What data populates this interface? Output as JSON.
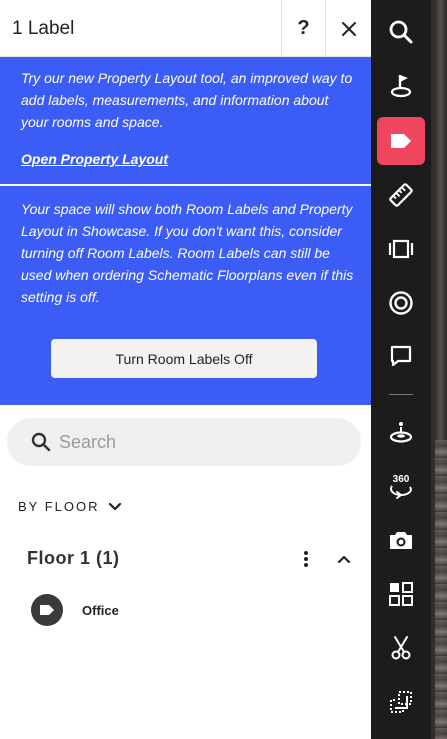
{
  "header": {
    "title": "1 Label",
    "help_label": "?"
  },
  "banner": {
    "intro": "Try our new Property Layout tool, an improved way to add labels, measurements, and information about your rooms and space.",
    "link": "Open Property Layout",
    "notice": "Your space will show both Room Labels and Property Layout in Showcase. If you don't want this, consider turning off Room Labels. Room Labels can still be used when ordering Schematic Floorplans even if this setting is off.",
    "button": "Turn Room Labels Off",
    "color": "#3b5cf5"
  },
  "search": {
    "placeholder": "Search",
    "value": ""
  },
  "filter": {
    "label": "BY FLOOR"
  },
  "floors": [
    {
      "title": "Floor 1 (1)",
      "labels": [
        {
          "name": "Office"
        }
      ]
    }
  ],
  "toolbar": {
    "active_color": "#f0455f",
    "tools": [
      {
        "icon": "search-icon",
        "active": false
      },
      {
        "icon": "start-location-icon",
        "active": false
      },
      {
        "icon": "label-tag-icon",
        "active": true
      },
      {
        "icon": "measure-ruler-icon",
        "active": false
      },
      {
        "icon": "view-frame-icon",
        "active": false
      },
      {
        "icon": "mattertag-target-icon",
        "active": false
      },
      {
        "icon": "comment-icon",
        "active": false
      },
      {
        "icon": "floor-position-icon",
        "active": false
      },
      {
        "icon": "360-rotate-icon",
        "active": false,
        "text": "360"
      },
      {
        "icon": "camera-icon",
        "active": false
      },
      {
        "icon": "grid-layout-icon",
        "active": false
      },
      {
        "icon": "scissors-icon",
        "active": false
      },
      {
        "icon": "crop-select-icon",
        "active": false
      }
    ]
  }
}
